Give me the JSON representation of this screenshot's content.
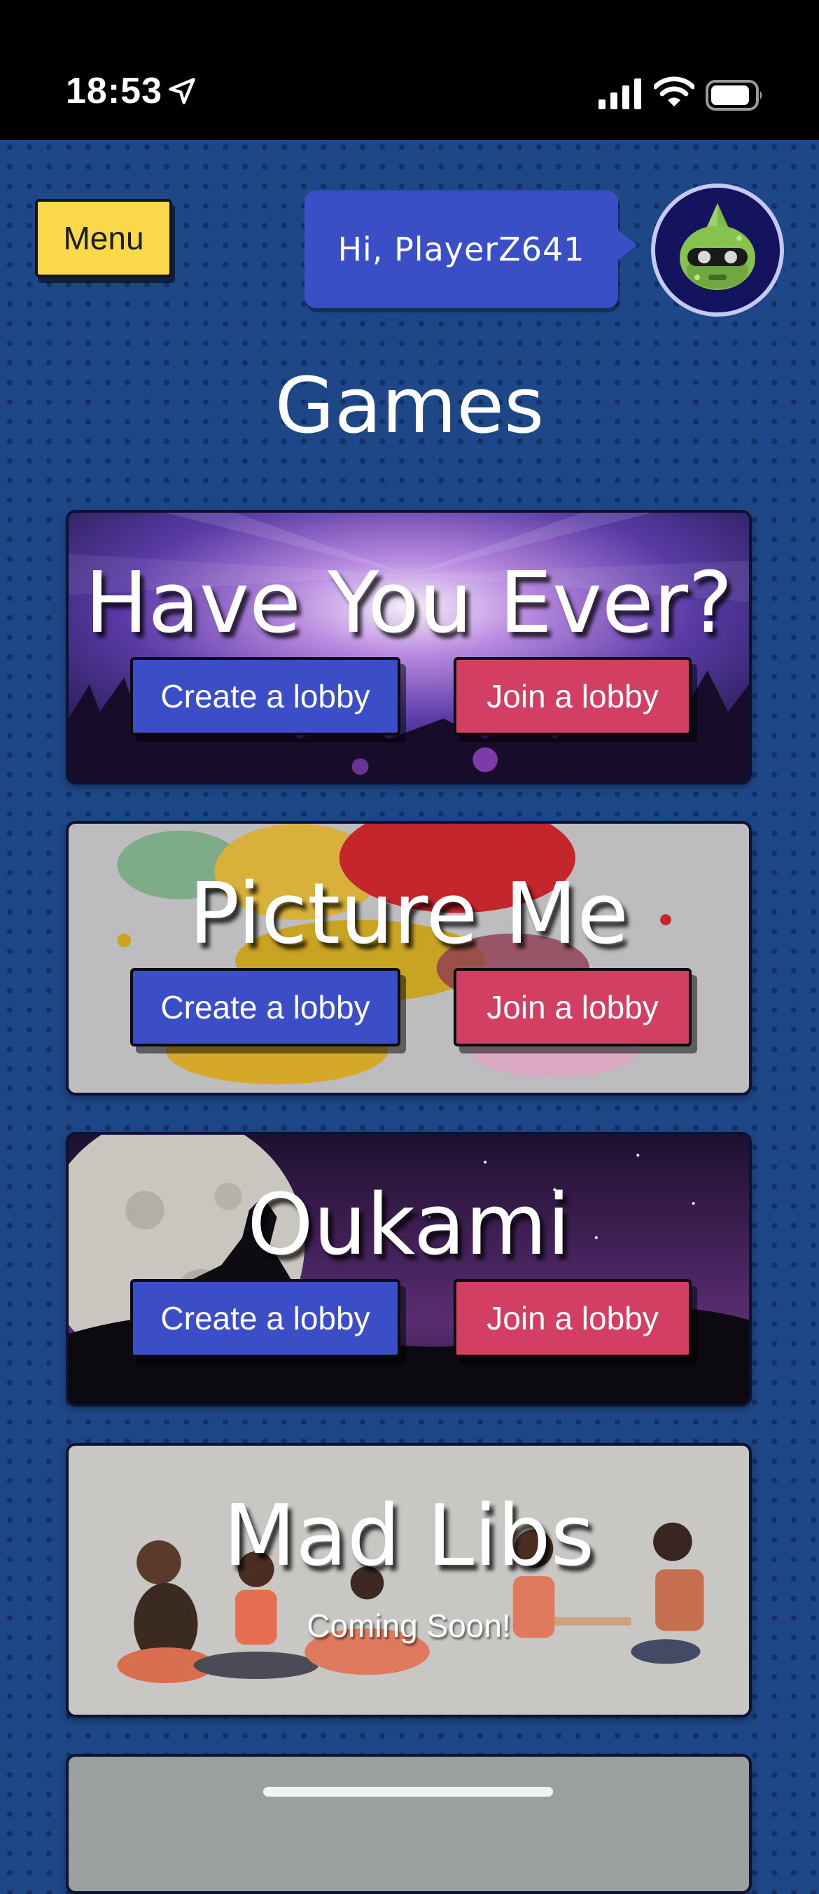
{
  "status_bar": {
    "time": "18:53"
  },
  "header": {
    "menu_label": "Menu",
    "greeting": "Hi, PlayerZ641"
  },
  "page": {
    "title": "Games"
  },
  "games": [
    {
      "title": "Have You Ever?",
      "create_label": "Create a lobby",
      "join_label": "Join a lobby"
    },
    {
      "title": "Picture Me",
      "create_label": "Create a lobby",
      "join_label": "Join a lobby"
    },
    {
      "title": "Oukami",
      "create_label": "Create a lobby",
      "join_label": "Join a lobby"
    },
    {
      "title": "Mad Libs",
      "status": "Coming Soon!"
    }
  ],
  "colors": {
    "background": "#1e4788",
    "menu_button": "#f9d84a",
    "greeting_bubble": "#3a4fc6",
    "create_button": "#3b4ec8",
    "join_button": "#d33e63"
  },
  "icons": [
    "location-arrow-icon",
    "cellular-signal-icon",
    "wifi-icon",
    "battery-icon",
    "robot-avatar-icon"
  ]
}
